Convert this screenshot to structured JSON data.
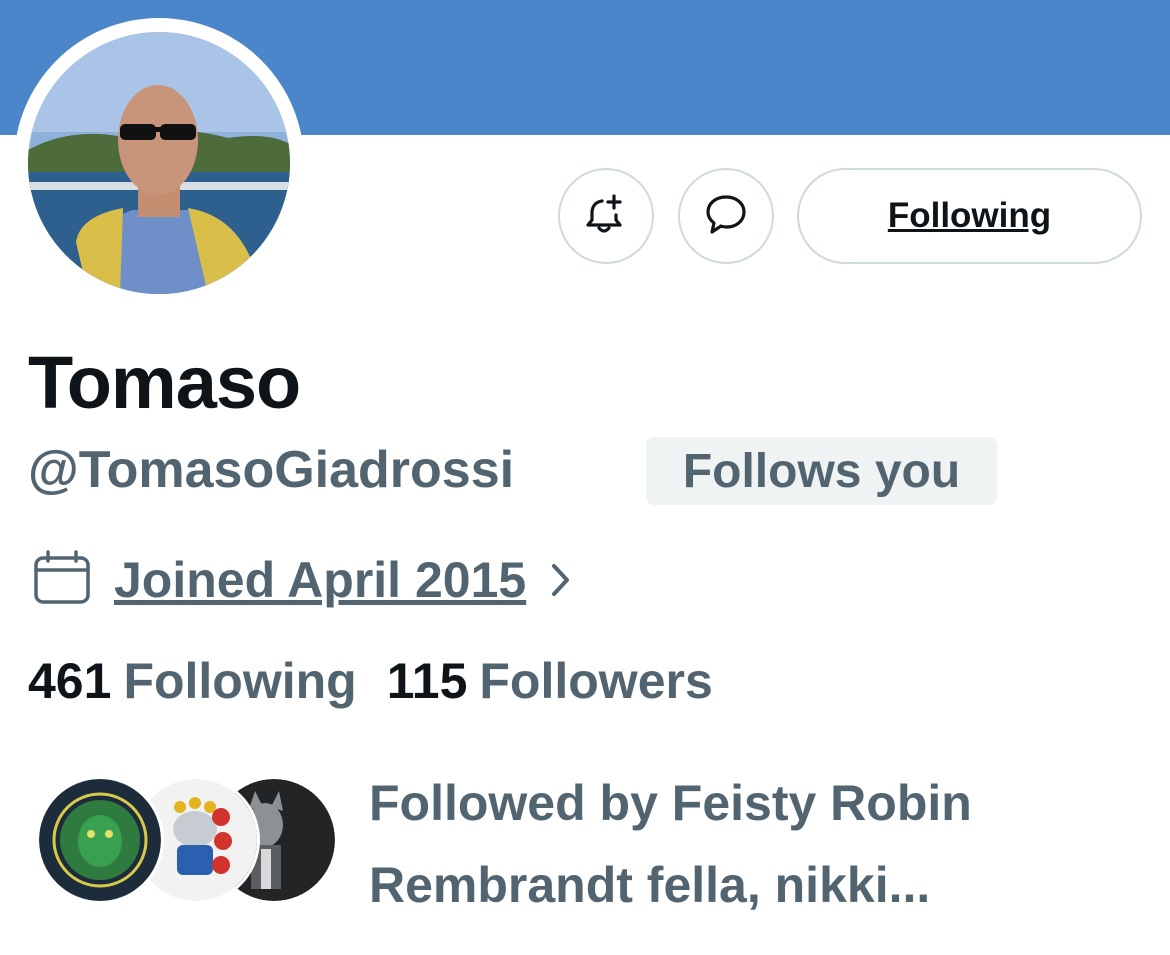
{
  "profile": {
    "name": "Tomaso",
    "handle": "@TomasoGiadrossi",
    "follows_you": "Follows you",
    "joined": "Joined April 2015",
    "following_count": "461",
    "following_label": "Following",
    "followers_count": "115",
    "followers_label": "Followers",
    "followed_by": "Followed by Feisty Robin Rembrandt fella, nikki..."
  },
  "actions": {
    "follow_button": "Following",
    "notifications_icon": "bell-plus-icon",
    "message_icon": "chat-bubble-icon"
  },
  "colors": {
    "banner": "#4a86c9",
    "text_primary": "#0f1419",
    "text_secondary": "#536471",
    "border": "#cfd9de",
    "badge_bg": "#eff3f4"
  }
}
